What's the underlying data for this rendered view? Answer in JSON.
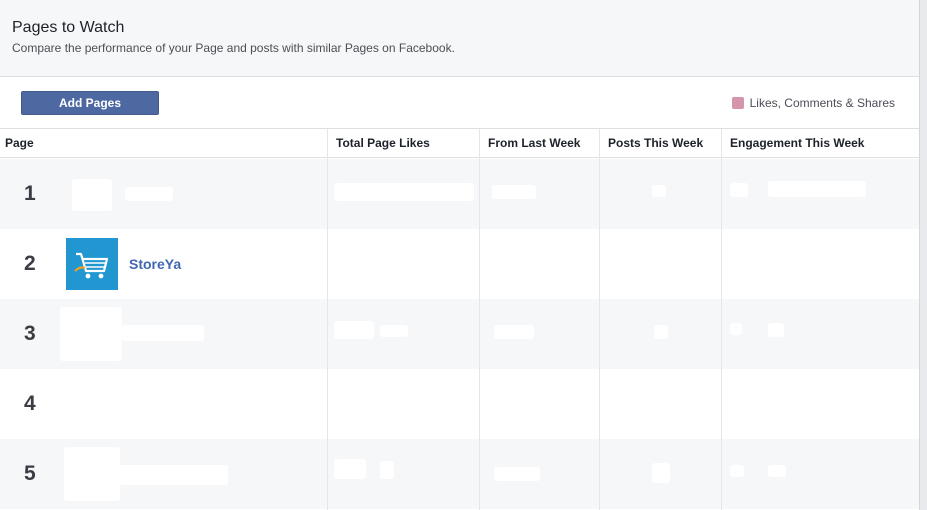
{
  "header": {
    "title": "Pages to Watch",
    "subtitle": "Compare the performance of your Page and posts with similar Pages on Facebook."
  },
  "toolbar": {
    "add_pages_label": "Add Pages",
    "legend_label": "Likes, Comments & Shares",
    "legend_color": "#d495ad"
  },
  "table": {
    "columns": [
      "Page",
      "Total Page Likes",
      "From Last Week",
      "Posts This Week",
      "Engagement This Week"
    ],
    "rows": [
      {
        "rank": "1",
        "name": ""
      },
      {
        "rank": "2",
        "name": "StoreYa",
        "icon": "shopping-cart-icon",
        "icon_color": "#2196d0"
      },
      {
        "rank": "3",
        "name": ""
      },
      {
        "rank": "4",
        "name": ""
      },
      {
        "rank": "5",
        "name": ""
      }
    ]
  }
}
